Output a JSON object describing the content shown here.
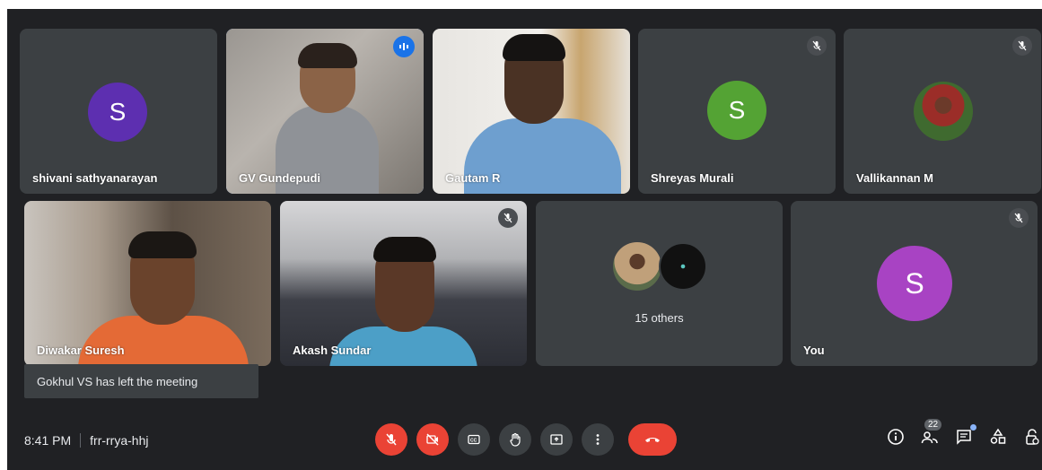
{
  "meeting": {
    "time": "8:41 PM",
    "code": "frr-rrya-hhj"
  },
  "participants": {
    "p1": {
      "name": "shivani sathyanarayan",
      "initial": "S",
      "color": "#5d2fb0"
    },
    "p2": {
      "name": "GV Gundepudi"
    },
    "p3": {
      "name": "Gautam R"
    },
    "p4": {
      "name": "Shreyas Murali",
      "initial": "S",
      "color": "#54a334"
    },
    "p5": {
      "name": "Vallikannan M"
    },
    "p6": {
      "name": "Diwakar Suresh"
    },
    "p7": {
      "name": "Akash Sundar"
    },
    "others": {
      "label": "15 others"
    },
    "you": {
      "name": "You",
      "initial": "S",
      "color": "#a843c3"
    }
  },
  "toast": {
    "text": "Gokhul VS has left the meeting"
  },
  "toolbar": {
    "people_count": "22"
  },
  "icons": {
    "mic": "mic-off-icon",
    "camera": "camera-off-icon",
    "captions": "captions-icon",
    "hand": "raise-hand-icon",
    "present": "present-icon",
    "more": "more-options-icon",
    "hangup": "hang-up-icon",
    "info": "info-icon",
    "people": "people-icon",
    "chat": "chat-icon",
    "activities": "activities-icon",
    "lock": "host-controls-icon"
  }
}
